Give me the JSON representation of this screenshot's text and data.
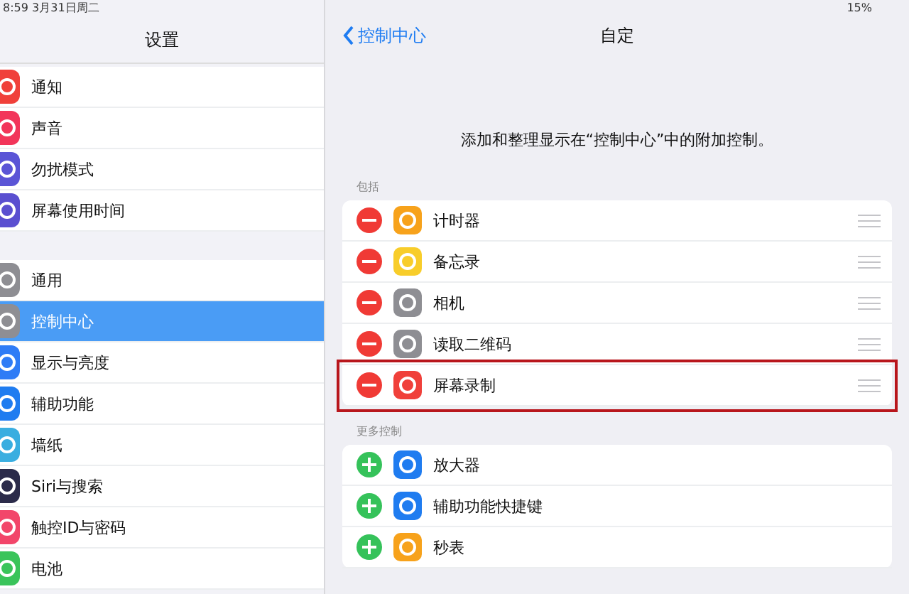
{
  "status_bar": {
    "time": "8:59  3月31日周二",
    "battery": "15%"
  },
  "sidebar": {
    "title": "设置",
    "groups": [
      {
        "items": [
          {
            "label": "通知",
            "color": "#f0403a",
            "selected": false
          },
          {
            "label": "声音",
            "color": "#f2355a",
            "selected": false
          },
          {
            "label": "勿扰模式",
            "color": "#5b55d6",
            "selected": false
          },
          {
            "label": "屏幕使用时间",
            "color": "#5a4fd0",
            "selected": false
          }
        ]
      },
      {
        "items": [
          {
            "label": "通用",
            "color": "#8e8e93",
            "selected": false
          },
          {
            "label": "控制中心",
            "color": "#8e8e93",
            "selected": true
          },
          {
            "label": "显示与亮度",
            "color": "#2f7cf6",
            "selected": false
          },
          {
            "label": "辅助功能",
            "color": "#1f7cf0",
            "selected": false
          },
          {
            "label": "墙纸",
            "color": "#3aaee0",
            "selected": false
          },
          {
            "label": "Siri与搜索",
            "color": "#2b2b4a",
            "selected": false
          },
          {
            "label": "触控ID与密码",
            "color": "#f2466a",
            "selected": false
          },
          {
            "label": "电池",
            "color": "#3ac45a",
            "selected": false
          }
        ]
      }
    ]
  },
  "detail": {
    "back": "控制中心",
    "title": "自定",
    "description": "添加和整理显示在“控制中心”中的附加控制。",
    "sections": [
      {
        "header": "包括",
        "kind": "remove",
        "items": [
          {
            "label": "计时器",
            "color": "#f7a21b",
            "highlighted": false
          },
          {
            "label": "备忘录",
            "color": "#f8cd2a",
            "highlighted": false
          },
          {
            "label": "相机",
            "color": "#8e8e93",
            "highlighted": false
          },
          {
            "label": "读取二维码",
            "color": "#8e8e93",
            "highlighted": false
          },
          {
            "label": "屏幕录制",
            "color": "#f0403a",
            "highlighted": true
          }
        ]
      },
      {
        "header": "更多控制",
        "kind": "add",
        "items": [
          {
            "label": "放大器",
            "color": "#1f7cf0",
            "highlighted": false
          },
          {
            "label": "辅助功能快捷键",
            "color": "#1f7cf0",
            "highlighted": false
          },
          {
            "label": "秒表",
            "color": "#f7a21b",
            "highlighted": false
          }
        ]
      }
    ]
  }
}
